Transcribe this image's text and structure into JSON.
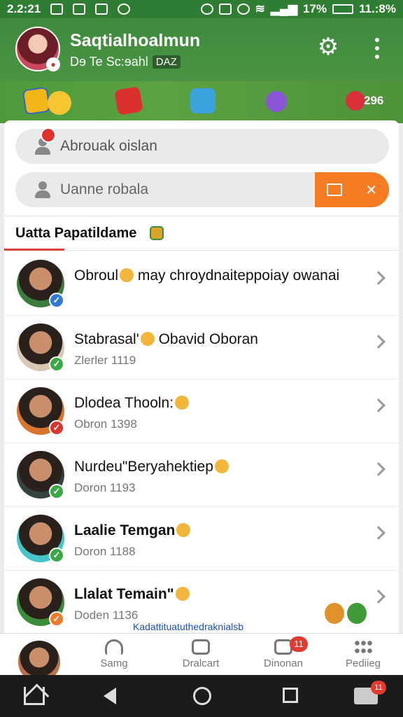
{
  "status_bar": {
    "time_left": "2.2:21",
    "battery_pct": "17%",
    "time_right": "11.:8%"
  },
  "header": {
    "title": "Saqtialhoalmun",
    "subtitle": "Dɘ Te Sc:ɘahl",
    "subtitle_tag": "DAZ",
    "icons": [
      "gear-icon",
      "more-vert-icon"
    ]
  },
  "banner": {
    "badge_count": "296"
  },
  "search": {
    "primary_placeholder": "Abrouak oislan",
    "secondary_placeholder": "Uanne robala"
  },
  "section": {
    "title": "Uatta Papatildame"
  },
  "contacts": [
    {
      "name": "Obroul",
      "name_after": " may chroydnaiteppoiay owanai",
      "subtitle": "",
      "badge_color": "#2f7ad6",
      "avatar_bg": "#3b7b3b",
      "bold": false
    },
    {
      "name": "Stabrasal'",
      "name_after": " Obavid Oboran",
      "subtitle": "Zlerler 1119",
      "badge_color": "#3aa845",
      "avatar_bg": "#d8c7b4",
      "bold": false
    },
    {
      "name": "Dlodea Thooln:",
      "name_after": "",
      "subtitle": "Obron 1398",
      "badge_color": "#d9342d",
      "avatar_bg": "#d8752f",
      "bold": false
    },
    {
      "name": "Nurdeu\"Beryahektiep",
      "name_after": "",
      "subtitle": "Doron 1193",
      "badge_color": "#3aa845",
      "avatar_bg": "#36423d",
      "bold": false
    },
    {
      "name": "Laalie Temgan",
      "name_after": "",
      "subtitle": "Doron 1188",
      "badge_color": "#3aa845",
      "avatar_bg": "#45c4c9",
      "bold": true
    },
    {
      "name": "Llalat Temain\"",
      "name_after": "",
      "subtitle": "Doden 1136",
      "badge_color": "#f0792a",
      "avatar_bg": "#3b8c3b",
      "bold": true,
      "link": "Kadattituatuthedraknialsb"
    }
  ],
  "bottom_nav": {
    "items": [
      {
        "label": "Samg",
        "icon": "home-icon"
      },
      {
        "label": "Dralcart",
        "icon": "edit-icon"
      },
      {
        "label": "Dinonan",
        "icon": "message-icon",
        "count": "11"
      },
      {
        "label": "Pediieg",
        "icon": "apps-icon"
      }
    ]
  },
  "system_nav": {
    "extra_count": "11"
  },
  "colors": {
    "brand_green": "#3e8a3e",
    "accent_orange": "#f57c22",
    "alert_red": "#e13a2e"
  }
}
